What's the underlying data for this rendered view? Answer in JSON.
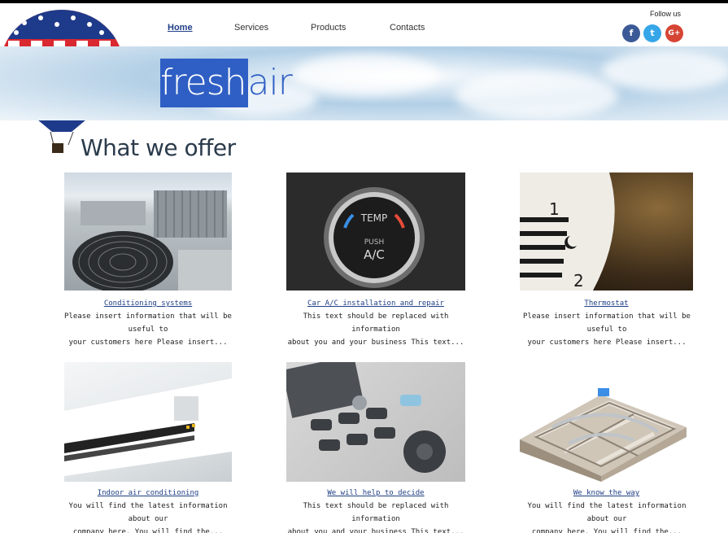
{
  "nav": {
    "items": [
      {
        "label": "Home",
        "active": true
      },
      {
        "label": "Services",
        "active": false
      },
      {
        "label": "Products",
        "active": false
      },
      {
        "label": "Contacts",
        "active": false
      }
    ]
  },
  "social": {
    "follow_label": "Follow us",
    "icons": [
      "facebook-icon",
      "twitter-icon",
      "google-plus-icon"
    ],
    "glyphs": {
      "facebook": "f",
      "twitter": "t",
      "google": "G+"
    }
  },
  "logo": {
    "part1": "fresh",
    "part2": "air"
  },
  "page": {
    "title": "What we offer"
  },
  "cards": [
    {
      "link": "Conditioning systems",
      "line1": "Please insert information that will be useful to",
      "line2": "your customers here Please insert..."
    },
    {
      "link": "Car A/C installation and repair",
      "line1": "This text should be replaced with information",
      "line2": "about you and your business This text..."
    },
    {
      "link": "Thermostat",
      "line1": "Please insert information that will be useful to",
      "line2": "your customers here Please insert..."
    },
    {
      "link": "Indoor air conditioning",
      "line1": "You will find the latest information about our",
      "line2": "company here. You will find the..."
    },
    {
      "link": "We will help to decide",
      "line1": "This text should be replaced with information",
      "line2": "about you and your business This text..."
    },
    {
      "link": "We know the way",
      "line1": "You will find the latest information about our",
      "line2": "company here. You will find the..."
    }
  ],
  "images": {
    "card2_dial_text1": "TEMP",
    "card2_dial_text2": "PUSH",
    "card2_dial_text3": "A/C",
    "card3_numerals": [
      "1",
      "2"
    ]
  },
  "colors": {
    "brand": "#2f5fc4",
    "link": "#1f3f86",
    "facebook": "#3b5a96",
    "twitter": "#36a6e8",
    "google": "#d64534"
  }
}
